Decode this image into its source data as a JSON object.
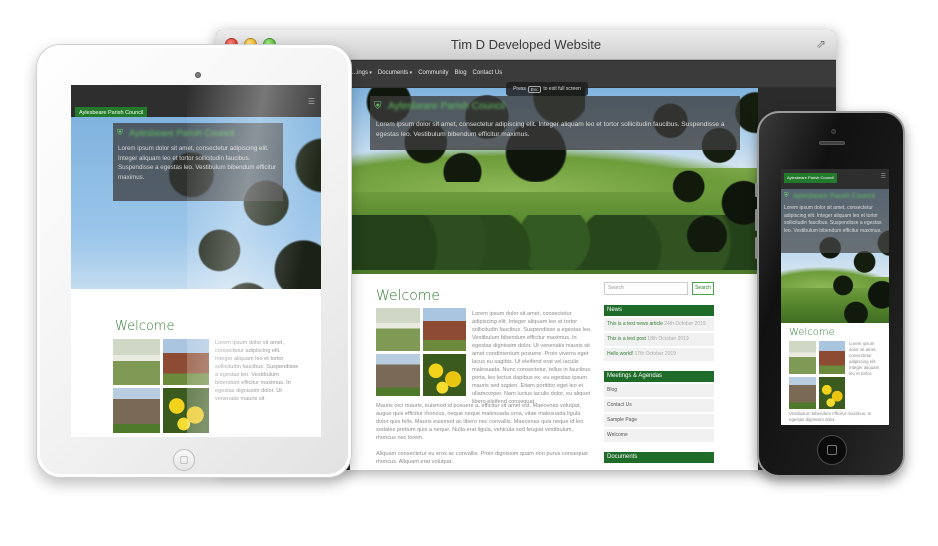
{
  "browser": {
    "window_title": "Tim D Developed Website",
    "nav_items": [
      "...ings",
      "Documents",
      "Community",
      "Blog",
      "Contact Us"
    ],
    "fullscreen_tip": {
      "prefix": "Press",
      "key": "Esc",
      "suffix": "to exit full screen"
    }
  },
  "site": {
    "brand": "Aylesbeare Parish Council",
    "hero_title": "Aylesbeare Parish Council",
    "hero_text": "Lorem ipsum dolor sit amet, consectetur adipiscing elit. Integer aliquam leo et tortor sollicitudin faucibus. Suspendisse a egestas leo. Vestibulum bibendum efficitur maximus.",
    "welcome": "Welcome",
    "body_text": "Lorem ipsum dolor sit amet, consectetur adipiscing elit. Integer aliquam leo et tortor sollicitudin faucibus. Suspendisse a egestas leo. Vestibulum bibendum efficitur maximus. In egestas dignissim dolor. Ut venenatis mauris sit amet condimentum posuere. Proin viverra eget lacus eu sagittis. Ut eleifend erat vel iaculis malesuada. Nunc consectetur, tellus in faucibus porta, leo lectus dapibus ex, eu egestas ipsum mauris sed sapien. Etiam porttitor eget leo et ullamcorper. Nam luctus iaculis dolor, eu aliquet libero eleifend consequat.",
    "body_text_full": "Mauris orci mauris, euismod id posuere a, efficitur sit amet est. Maecenas volutpat, augue quis efficitur rhoncus, neque neque malesuada urna, vitae malesuada ligula dolor quis felis. Mauris euismod ac libero nec convallis. Maecenas quis neque id leo sodales pretium quis a neque. Nulla erat ligula, vehicula sed feugiat vestibulum, rhoncus nec lorem.",
    "body_text_more": "Aliquam consectetur eu eros ac convallis. Proin dignissim quam non purus consequat rhoncus. Aliquam erat volutpat.",
    "tablet_text": "Lorem ipsum dolor sit amet, consectetur adipiscing elit. Integer aliquam leo et tortor sollicitudin faucibus. Suspendisse a egestas leo. Vestibulum bibendum efficitur maximus. In egestas dignissim dolor. Ut venenatis mauris sit",
    "phone_text": "Lorem ipsum dolor sit amet, consectetur adipiscing elit. Integer aliquam leo et tortor.",
    "phone_text2": "Vestibulum bibendum efficitur maximus. In egestas dignissim dolor."
  },
  "sidebar": {
    "search_placeholder": "Search",
    "search_button": "Search",
    "news_heading": "News",
    "news": [
      {
        "title": "This is a test news article",
        "date": "24th October 2019"
      },
      {
        "title": "This is a test post",
        "date": "18th October 2019"
      },
      {
        "title": "Hello world!",
        "date": "17th October 2019"
      }
    ],
    "meetings_heading": "Meetings & Agendas",
    "pages": [
      "Blog",
      "Contact Us",
      "Sample Page",
      "Welcome"
    ],
    "documents_heading": "Documents"
  },
  "colors": {
    "brand_green": "#1f6b2a",
    "accent_green": "#2f7d2f"
  }
}
